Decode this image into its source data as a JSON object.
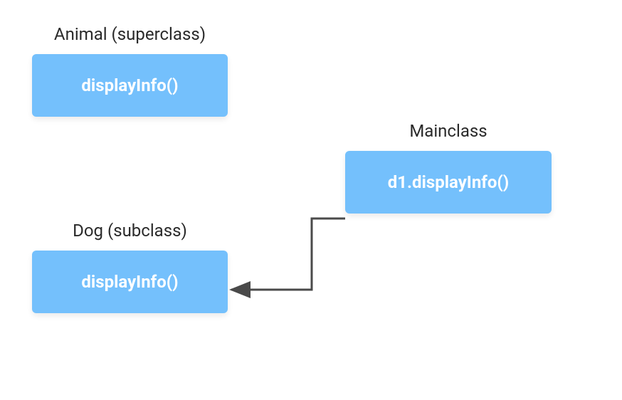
{
  "diagram": {
    "nodes": {
      "animal": {
        "label": "Animal (superclass)",
        "method": "displayInfo()"
      },
      "dog": {
        "label": "Dog (subclass)",
        "method": "displayInfo()"
      },
      "main": {
        "label": "Mainclass",
        "method": "d1.displayInfo()"
      }
    },
    "edges": [
      {
        "from": "main",
        "to": "dog",
        "type": "calls"
      }
    ],
    "colors": {
      "box_fill": "#74c0fc",
      "box_text": "#ffffff",
      "label_text": "#2a2a2a",
      "arrow": "#4a4a4a"
    }
  }
}
